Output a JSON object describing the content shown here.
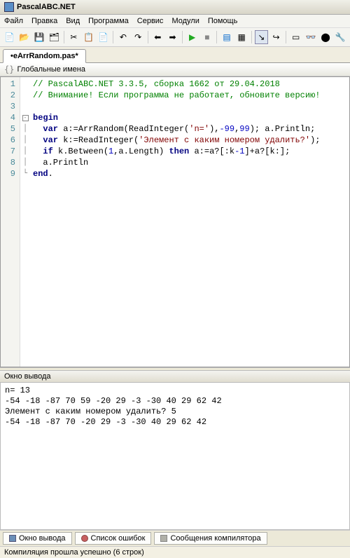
{
  "title": "PascalABC.NET",
  "menu": [
    "Файл",
    "Правка",
    "Вид",
    "Программа",
    "Сервис",
    "Модули",
    "Помощь"
  ],
  "tab": "•eArrRandom.pas*",
  "nav": "Глобальные имена",
  "code": {
    "l1a": "// PascalABC.NET 3.3.5, сборка 1662 от 29.04.2018",
    "l2a": "// Внимание! Если программа не работает, обновите версию!",
    "l4_kw": "begin",
    "l5_var": "var",
    "l5_a": " a:=ArrRandom(ReadInteger(",
    "l5_s": "'n='",
    "l5_b": "),",
    "l5_n1": "-99",
    "l5_c": ",",
    "l5_n2": "99",
    "l5_d": "); a.Println;",
    "l6_var": "var",
    "l6_a": " k:=ReadInteger(",
    "l6_s": "'Элемент с каким номером удалить?'",
    "l6_b": ");",
    "l7_if": "if",
    "l7_a": " k.Between(",
    "l7_n1": "1",
    "l7_b": ",a.Length) ",
    "l7_then": "then",
    "l7_c": " a:=a?[:k",
    "l7_n2": "-1",
    "l7_d": "]+a?[k:];",
    "l8": "a.Println",
    "l9_kw": "end",
    "l9_dot": "."
  },
  "gutter": [
    "1",
    "2",
    "3",
    "4",
    "5",
    "6",
    "7",
    "8",
    "9"
  ],
  "output_title": "Окно вывода",
  "output": "n= 13\n-54 -18 -87 70 59 -20 29 -3 -30 40 29 62 42\nЭлемент с каким номером удалить? 5\n-54 -18 -87 70 -20 29 -3 -30 40 29 62 42",
  "bottom_tabs": {
    "t1": "Окно вывода",
    "t2": "Список ошибок",
    "t3": "Сообщения компилятора"
  },
  "status": "Компиляция прошла успешно (6 строк)"
}
